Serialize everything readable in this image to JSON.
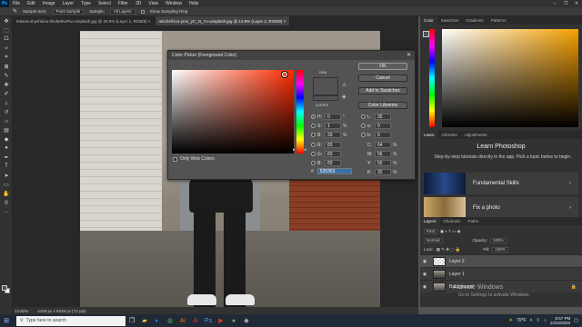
{
  "menubar": {
    "logo": "Ps",
    "items": [
      "File",
      "Edit",
      "Image",
      "Layer",
      "Type",
      "Select",
      "Filter",
      "3D",
      "View",
      "Window",
      "Help"
    ]
  },
  "options": {
    "sample_size_label": "Sample Size:",
    "sample_size_value": "Point Sample",
    "sample_label": "Sample:",
    "sample_value": "All Layers",
    "show_ring_label": "Show Sampling Ring"
  },
  "tabs": [
    {
      "label": "tetiana-shyshkina-thIvbMKuPw-unsplash.jpg @ 25.5% (Layer 1, RGB/8)",
      "active": false
    },
    {
      "label": "mitchell-luo-ymo_yC_N_7o-unsplash.jpg @ 14.8% (Layer 2, RGB/8)",
      "active": true
    }
  ],
  "status": {
    "zoom": "14.82%",
    "dims": "4159 px x 6239 px (72 ppi)"
  },
  "picker": {
    "title": "Color Picker (Foreground Color)",
    "new_label": "new",
    "current_label": "current",
    "ok": "OK",
    "cancel": "Cancel",
    "add_swatches": "Add to Swatches",
    "color_libraries": "Color Libraries",
    "web_only": "Only Web Colors",
    "fields": {
      "H": {
        "value": "0",
        "unit": "°"
      },
      "S": {
        "value": "1",
        "unit": "%"
      },
      "B": {
        "value": "33",
        "unit": "%"
      },
      "R": {
        "value": "83",
        "unit": ""
      },
      "G": {
        "value": "83",
        "unit": ""
      },
      "Bl": {
        "value": "83",
        "unit": ""
      },
      "L": {
        "value": "35",
        "unit": ""
      },
      "a": {
        "value": "0",
        "unit": ""
      },
      "b": {
        "value": "0",
        "unit": ""
      },
      "C": {
        "value": "64",
        "unit": "%"
      },
      "M": {
        "value": "56",
        "unit": "%"
      },
      "Y": {
        "value": "55",
        "unit": "%"
      },
      "K": {
        "value": "32",
        "unit": "%"
      }
    },
    "hex": "535353",
    "foreground_color": "#535353"
  },
  "right_panel": {
    "color_tabs": [
      "Color",
      "Swatches",
      "Gradients",
      "Patterns"
    ],
    "learn_tabs": [
      "Learn",
      "Libraries",
      "Adjustments"
    ],
    "learn_title": "Learn Photoshop",
    "learn_desc": "Step-by-step tutorials directly in the app. Pick a topic below to begin.",
    "cards": [
      "Fundamental Skills",
      "Fix a photo"
    ],
    "layers_tabs": [
      "Layers",
      "Channels",
      "Paths"
    ],
    "kind_label": "Kind",
    "normal": "Normal",
    "opacity_label": "Opacity:",
    "opacity_value": "100%",
    "lock_label": "Lock:",
    "fill_label": "Fill:",
    "fill_value": "100%",
    "layers": [
      {
        "name": "Layer 2",
        "selected": true
      },
      {
        "name": "Layer 1",
        "selected": false
      },
      {
        "name": "Background",
        "selected": false
      }
    ]
  },
  "watermark": {
    "line1": "Activate Windows",
    "line2": "Go to Settings to activate Windows."
  },
  "taskbar": {
    "search_placeholder": "Type here to search",
    "temp": "70°F",
    "time": "8:57 PM",
    "date": "12/22/2022"
  }
}
